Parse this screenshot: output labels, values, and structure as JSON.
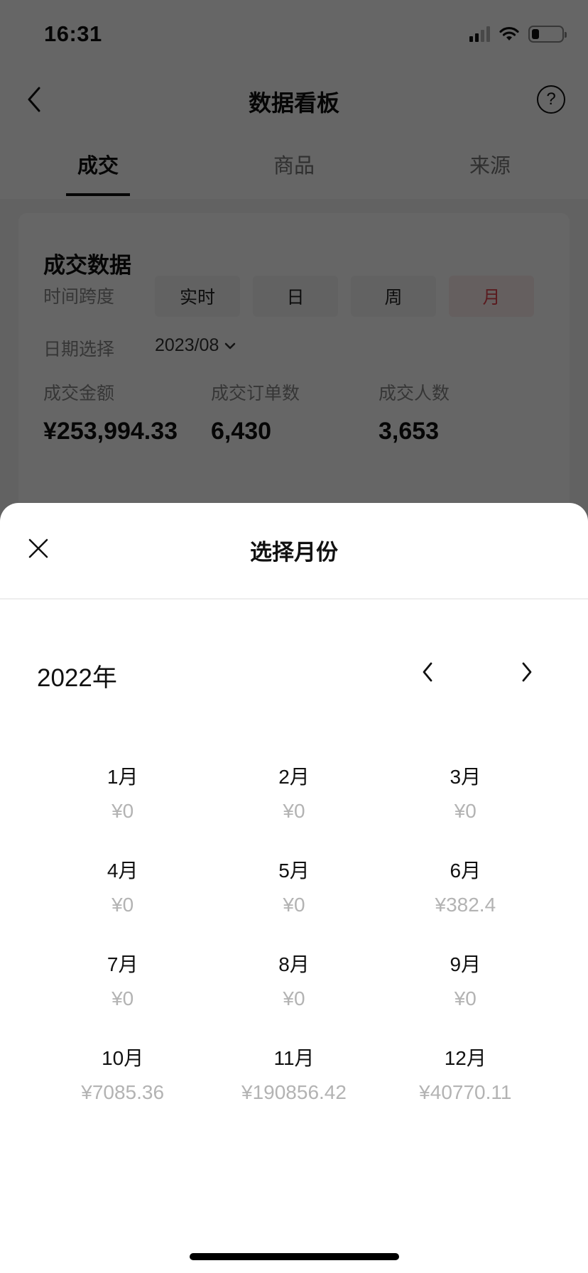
{
  "status_bar": {
    "time": "16:31",
    "icons": [
      "signal-icon",
      "wifi-icon",
      "battery-icon"
    ],
    "battery_level": 0.25
  },
  "nav": {
    "back_icon": "chevron-left-icon",
    "title": "数据看板",
    "help_icon": "question-circle-icon",
    "help_glyph": "?"
  },
  "tabs": [
    {
      "label": "成交",
      "active": true
    },
    {
      "label": "商品",
      "active": false
    },
    {
      "label": "来源",
      "active": false
    }
  ],
  "card": {
    "title": "成交数据",
    "time_span_label": "时间跨度",
    "time_span_options": [
      {
        "label": "实时",
        "active": false
      },
      {
        "label": "日",
        "active": false
      },
      {
        "label": "周",
        "active": false
      },
      {
        "label": "月",
        "active": true
      }
    ],
    "date_label": "日期选择",
    "date_value": "2023/08",
    "date_icon": "chevron-down-icon",
    "metrics": [
      {
        "label": "成交金额",
        "value": "¥253,994.33"
      },
      {
        "label": "成交订单数",
        "value": "6,430"
      },
      {
        "label": "成交人数",
        "value": "3,653"
      }
    ]
  },
  "sheet": {
    "close_icon": "close-icon",
    "title": "选择月份",
    "year_label": "2022年",
    "prev_icon": "chevron-left-icon",
    "next_icon": "chevron-right-icon",
    "months": [
      {
        "name": "1月",
        "amount": "¥0"
      },
      {
        "name": "2月",
        "amount": "¥0"
      },
      {
        "name": "3月",
        "amount": "¥0"
      },
      {
        "name": "4月",
        "amount": "¥0"
      },
      {
        "name": "5月",
        "amount": "¥0"
      },
      {
        "name": "6月",
        "amount": "¥382.4"
      },
      {
        "name": "7月",
        "amount": "¥0"
      },
      {
        "name": "8月",
        "amount": "¥0"
      },
      {
        "name": "9月",
        "amount": "¥0"
      },
      {
        "name": "10月",
        "amount": "¥7085.36"
      },
      {
        "name": "11月",
        "amount": "¥190856.42"
      },
      {
        "name": "12月",
        "amount": "¥40770.11"
      }
    ]
  },
  "colors": {
    "accent_red": "#e0444e",
    "amount_gray": "#b3b3b3",
    "overlay": "rgba(0,0,0,0.6)"
  }
}
